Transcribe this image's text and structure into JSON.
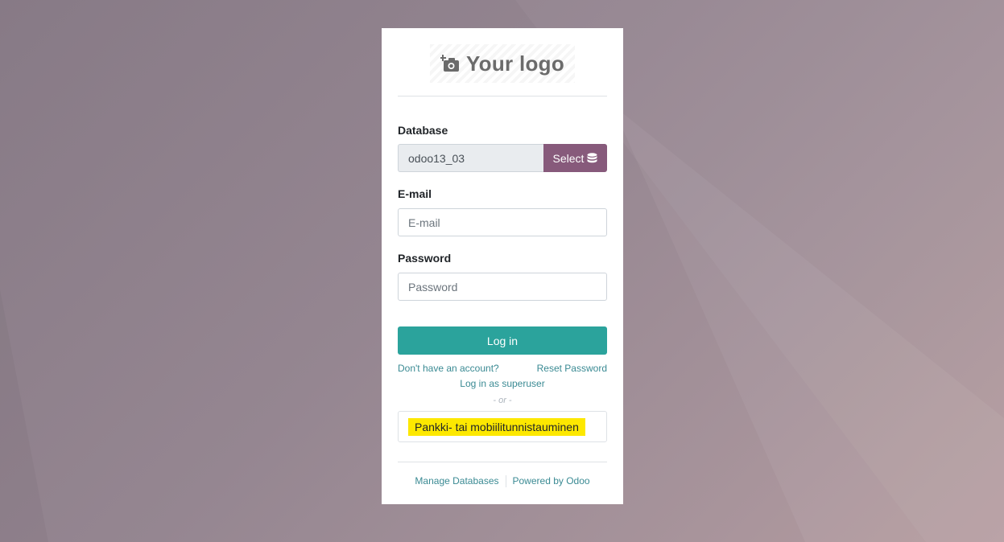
{
  "logo": {
    "text": "Your logo",
    "icon": "camera-plus-icon"
  },
  "database": {
    "label": "Database",
    "value": "odoo13_03",
    "select_label": "Select",
    "select_icon": "database-icon"
  },
  "email": {
    "label": "E-mail",
    "placeholder": "E-mail"
  },
  "password": {
    "label": "Password",
    "placeholder": "Password"
  },
  "login_button": "Log in",
  "links": {
    "signup": "Don't have an account?",
    "reset": "Reset Password",
    "superuser": "Log in as superuser"
  },
  "or_separator": "- or -",
  "oauth_provider": "Pankki- tai mobiilitunnistauminen",
  "footer": {
    "manage": "Manage Databases",
    "powered": "Powered by Odoo"
  },
  "colors": {
    "primary": "#875a7b",
    "login_button": "#2ba39c",
    "link": "#3a8a93",
    "highlight": "#fde800"
  }
}
